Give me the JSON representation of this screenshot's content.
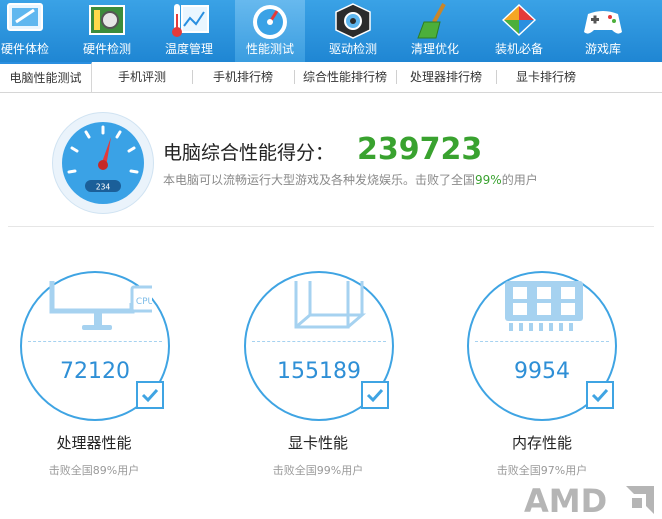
{
  "toolbar": {
    "items": [
      {
        "label": "硬件体检",
        "icon": "monitor-icon"
      },
      {
        "label": "硬件检测",
        "icon": "circuit-board-icon"
      },
      {
        "label": "温度管理",
        "icon": "thermometer-icon"
      },
      {
        "label": "性能测试",
        "icon": "speedometer-icon"
      },
      {
        "label": "驱动检测",
        "icon": "gear-cube-icon"
      },
      {
        "label": "清理优化",
        "icon": "broom-icon"
      },
      {
        "label": "装机必备",
        "icon": "apps-box-icon"
      },
      {
        "label": "游戏库",
        "icon": "gamepad-icon"
      }
    ],
    "active": "性能测试"
  },
  "tabs": {
    "items": [
      "电脑性能测试",
      "手机评测",
      "手机排行榜",
      "综合性能排行榜",
      "处理器排行榜",
      "显卡排行榜"
    ],
    "active": "电脑性能测试"
  },
  "score": {
    "title": "电脑综合性能得分：",
    "value": "239723",
    "desc_prefix": "本电脑可以流畅运行大型游戏及各种发烧娱乐。击败了全国",
    "desc_pct": "99%",
    "desc_suffix": "的用户",
    "gauge_readout": "234"
  },
  "components": [
    {
      "value": "72120",
      "title": "处理器性能",
      "sub": "击败全国89%用户",
      "chip_label": "CPU"
    },
    {
      "value": "155189",
      "title": "显卡性能",
      "sub": "击败全国99%用户"
    },
    {
      "value": "9954",
      "title": "内存性能",
      "sub": "击败全国97%用户"
    }
  ],
  "brand": {
    "logo_text": "AMD"
  },
  "colors": {
    "accent": "#1f86d3",
    "score_green": "#39a22f",
    "card_blue": "#3fa4e3"
  }
}
